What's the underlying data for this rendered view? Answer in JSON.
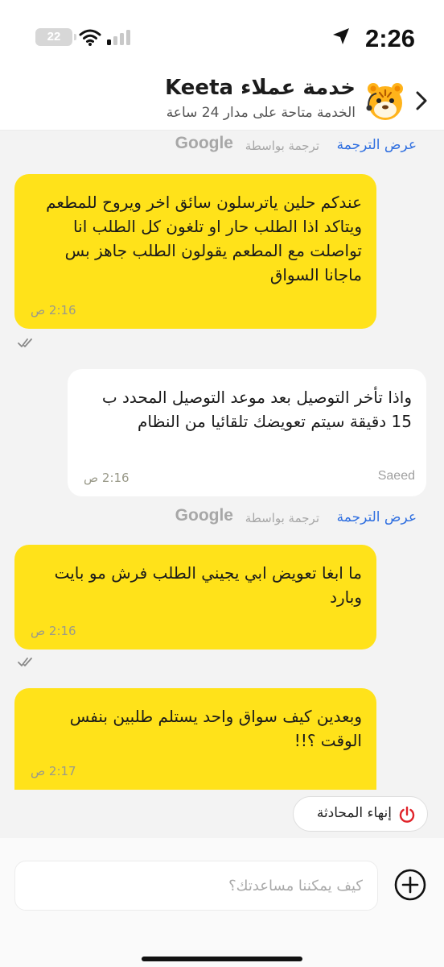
{
  "status_bar": {
    "time": "2:26",
    "battery": "22"
  },
  "header": {
    "title": "خدمة عملاء Keeta",
    "subtitle": "الخدمة متاحة على مدار 24 ساعة"
  },
  "translation": {
    "link": "عرض الترجمة",
    "via": "ترجمة بواسطة",
    "logo": "Google"
  },
  "messages": [
    {
      "side": "me",
      "text": "عندكم حلين ياترسلون سائق اخر ويروح للمطعم ويتاكد اذا الطلب حار او تلغون كل الطلب انا تواصلت مع المطعم يقولون الطلب جاهز بس ماجانا السواق",
      "time": "2:16 ص"
    },
    {
      "side": "them",
      "text": "واذا تأخر التوصيل بعد موعد التوصيل المحدد ب 15 دقيقة سيتم تعويضك تلقائيا من النظام",
      "time": "2:16 ص",
      "sender": "Saeed"
    },
    {
      "side": "me",
      "text": "ما ابغا تعويض ابي يجيني الطلب فرش مو بايت وبارد",
      "time": "2:16 ص"
    },
    {
      "side": "me",
      "text": "وبعدين كيف سواق واحد يستلم طلبين بنفس الوقت ؟!!",
      "time": "2:17 ص"
    }
  ],
  "end_chat_label": "إنهاء المحادثة",
  "composer": {
    "placeholder": "كيف يمكننا مساعدتك؟"
  },
  "colors": {
    "accent": "#ffe21a",
    "link": "#2f6fe0",
    "end_icon": "#e0242a"
  }
}
